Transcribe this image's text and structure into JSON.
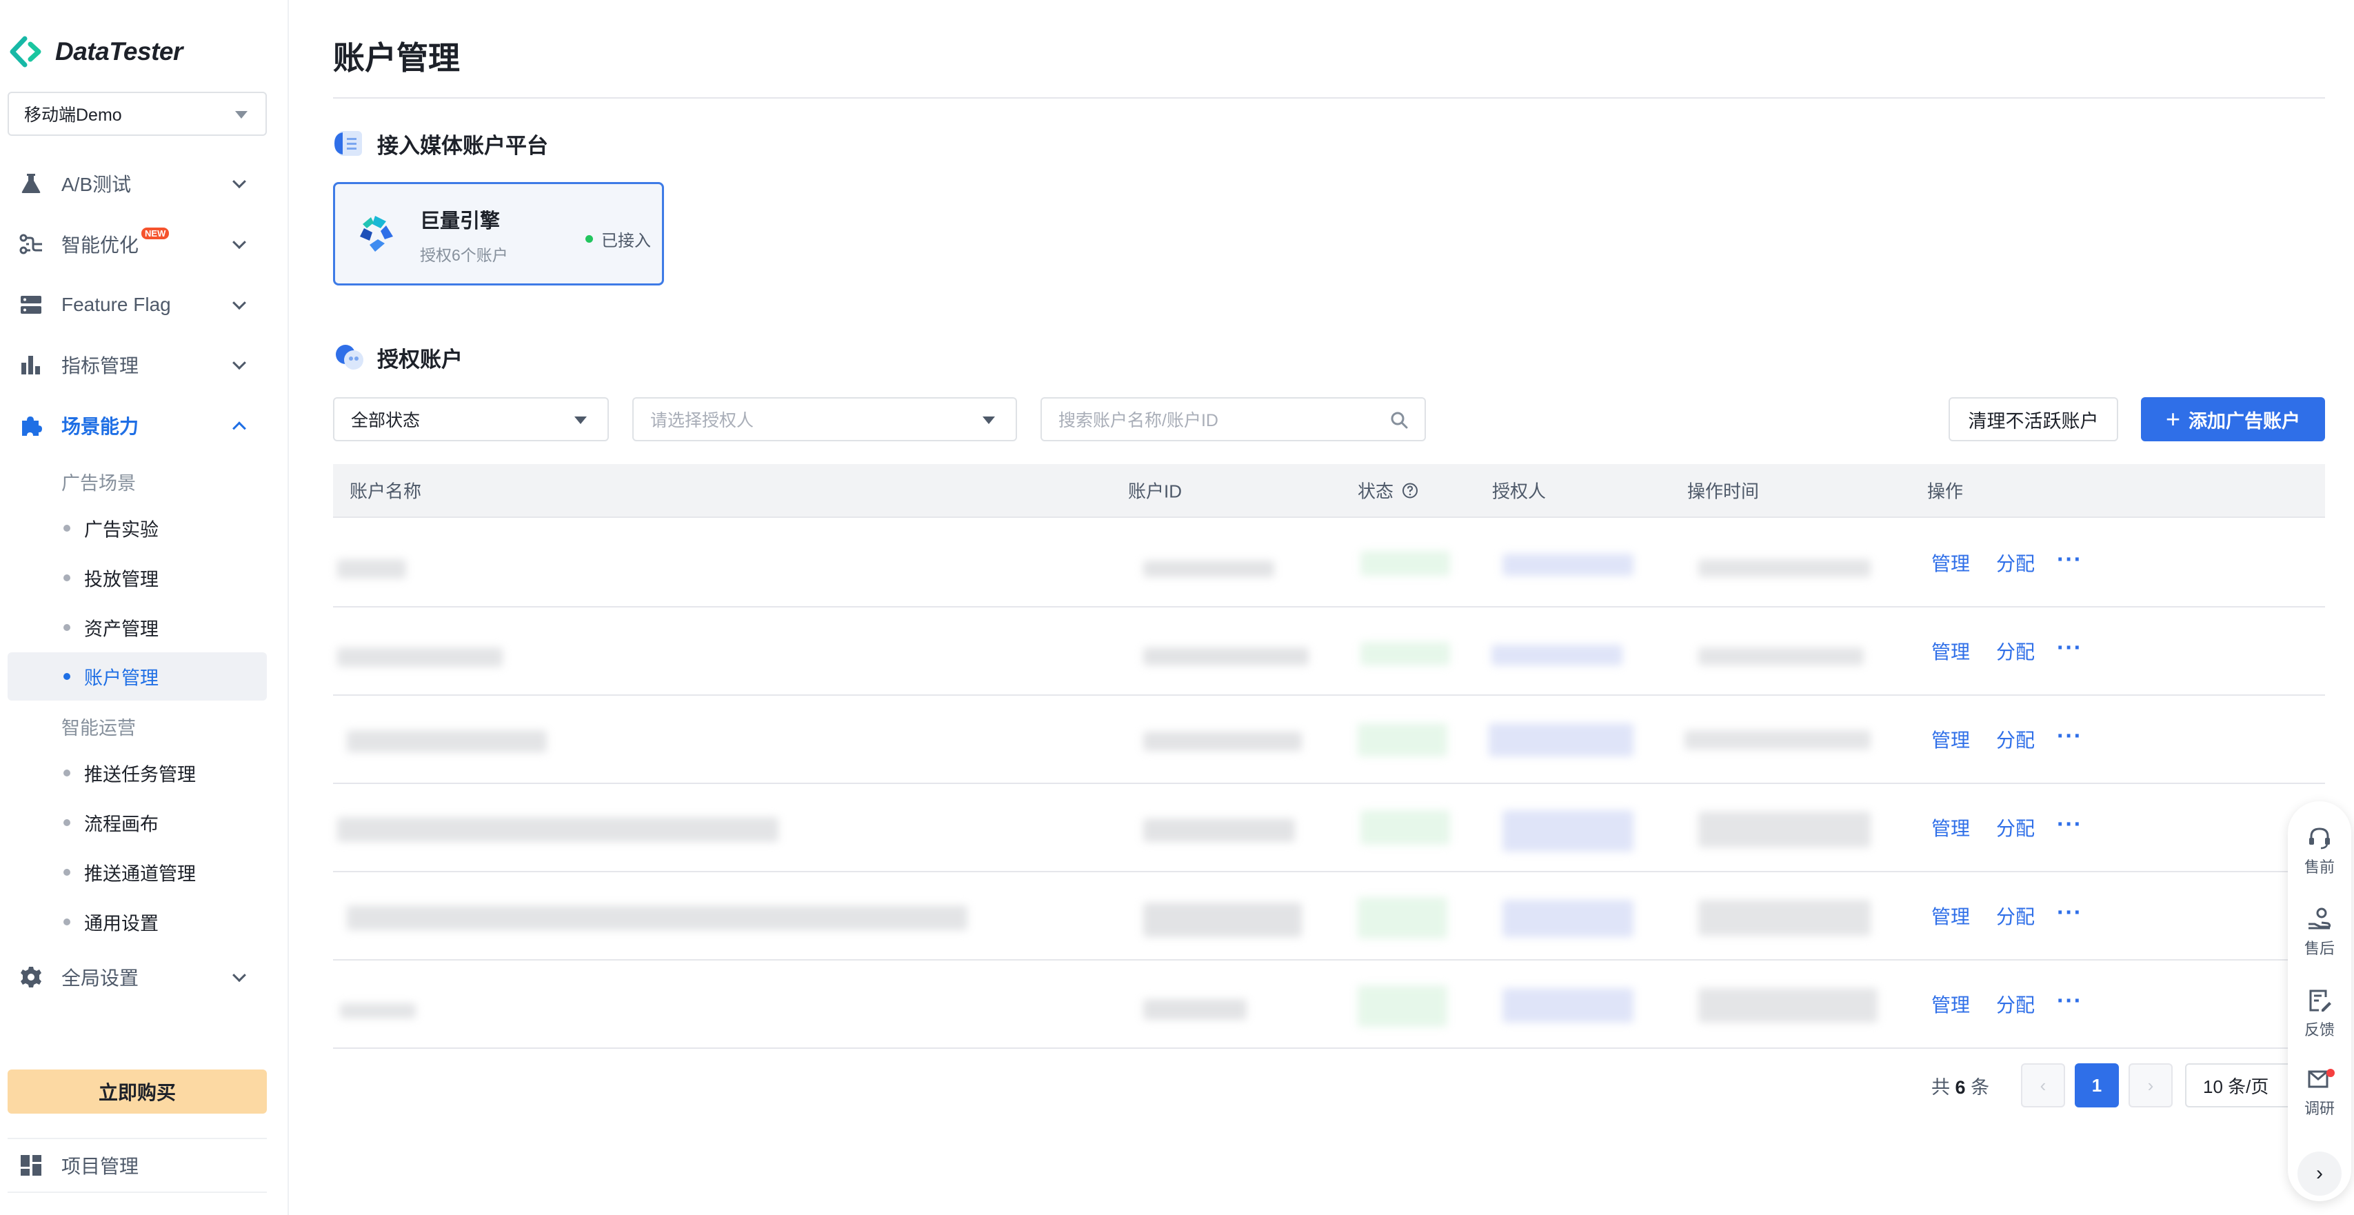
{
  "app": {
    "logo_text": "DataTester"
  },
  "project_selector": {
    "value": "移动端Demo"
  },
  "sidebar": {
    "nav": [
      {
        "label": "A/B测试",
        "icon": "flask-icon"
      },
      {
        "label": "智能优化",
        "icon": "flow-icon",
        "badge": "NEW"
      },
      {
        "label": "Feature Flag",
        "icon": "server-icon"
      },
      {
        "label": "指标管理",
        "icon": "bar-chart-icon"
      },
      {
        "label": "场景能力",
        "icon": "puzzle-icon"
      }
    ],
    "groups": [
      {
        "label": "广告场景",
        "items": [
          "广告实验",
          "投放管理",
          "资产管理",
          "账户管理"
        ]
      },
      {
        "label": "智能运营",
        "items": [
          "推送任务管理",
          "流程画布",
          "推送通道管理",
          "通用设置"
        ]
      }
    ],
    "global_settings": "全局设置",
    "buy_button": "立即购买",
    "project_management": "项目管理"
  },
  "page": {
    "title": "账户管理",
    "media_section_title": "接入媒体账户平台",
    "platform": {
      "name": "巨量引擎",
      "sub": "授权6个账户",
      "status": "已接入"
    },
    "accounts_section_title": "授权账户"
  },
  "filters": {
    "status_value": "全部状态",
    "authorizer_placeholder": "请选择授权人",
    "search_placeholder": "搜索账户名称/账户ID"
  },
  "actions": {
    "clean_inactive": "清理不活跃账户",
    "add_account": "添加广告账户"
  },
  "table": {
    "columns": [
      "账户名称",
      "账户ID",
      "状态",
      "授权人",
      "操作时间",
      "操作"
    ],
    "row_actions": {
      "manage": "管理",
      "assign": "分配",
      "more": "···"
    },
    "row_count": 6
  },
  "pagination": {
    "total_prefix": "共",
    "total": "6",
    "total_suffix": "条",
    "prev": "‹",
    "current_page": "1",
    "next": "›",
    "page_size": "10 条/页"
  },
  "help_dock": {
    "items": [
      "售前",
      "售后",
      "反馈",
      "调研"
    ],
    "next": "›"
  },
  "colors": {
    "primary": "#2f6fe8",
    "active_nav": "#1f6fe5",
    "buy_button_bg": "#fcd9a3",
    "logo_teal": "#17b8a6",
    "status_green": "#22c55e"
  }
}
